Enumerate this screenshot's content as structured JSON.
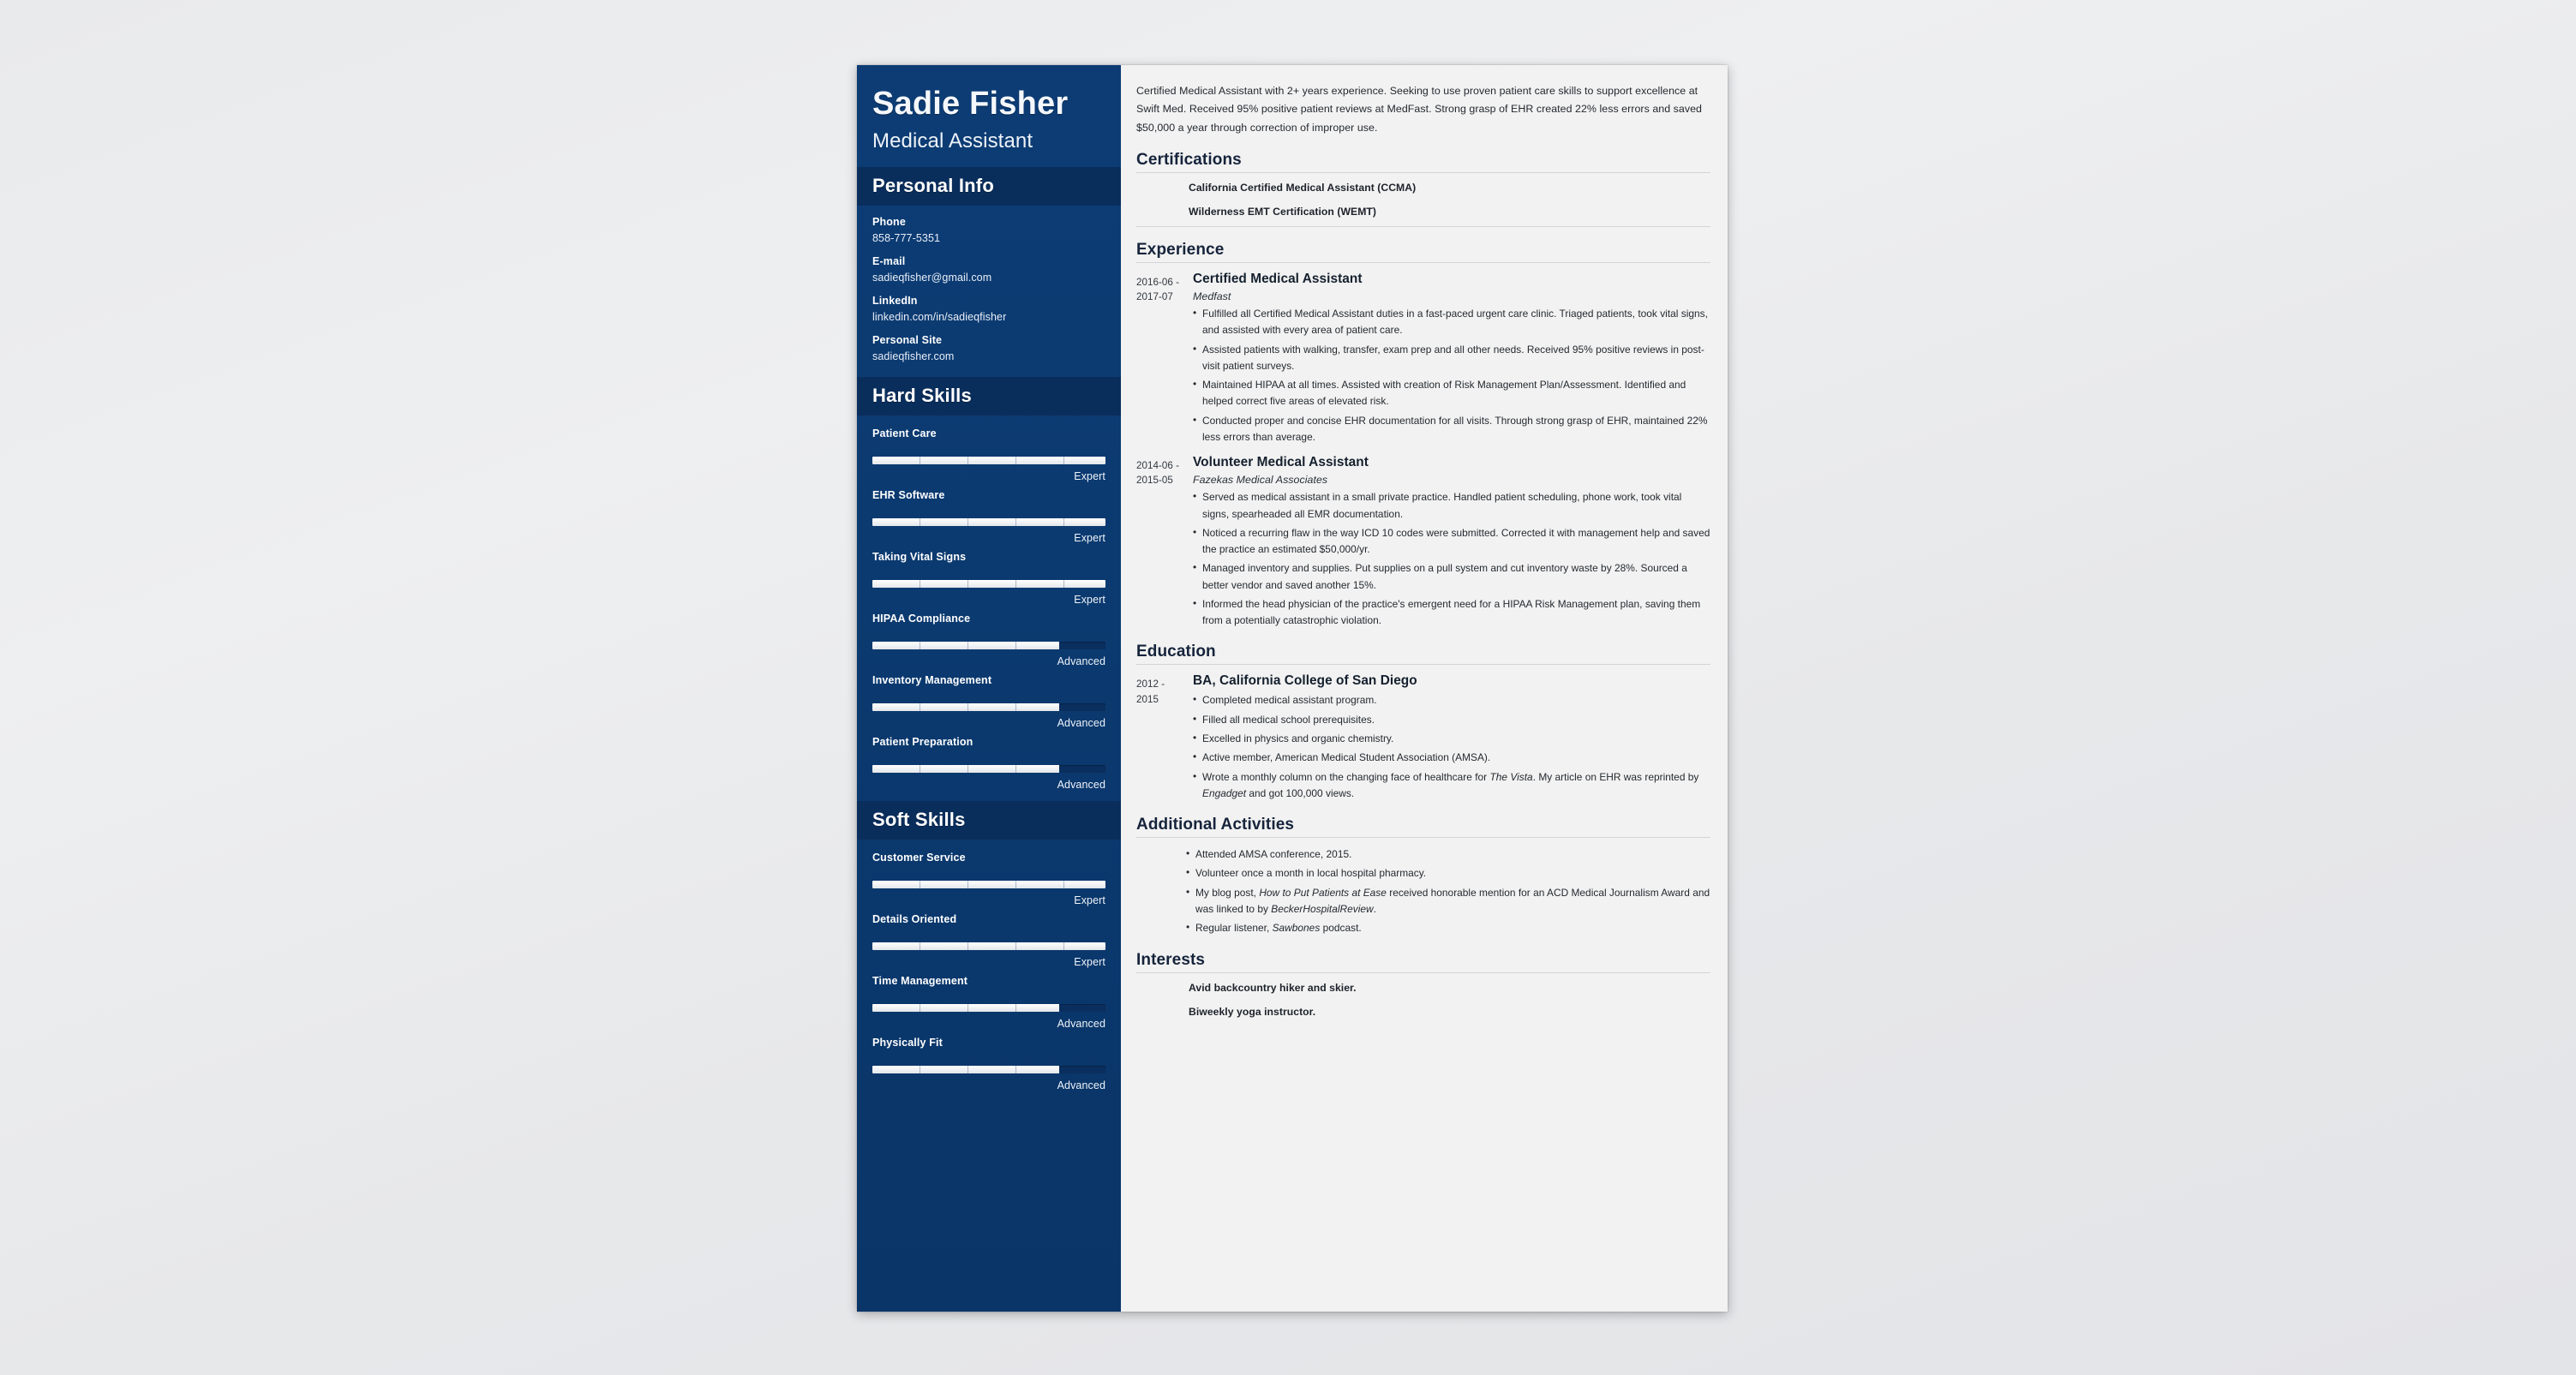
{
  "colors": {
    "sidebar_bg": "#0b3a70",
    "sidebar_header_bg": "#0a2e5c",
    "page_bg": "#f2f2f2",
    "heading_text": "#16243c",
    "bar_fill": "#ffffff"
  },
  "header": {
    "name": "Sadie Fisher",
    "job_title": "Medical Assistant"
  },
  "sidebar": {
    "personal_info": {
      "heading": "Personal Info",
      "items": [
        {
          "label": "Phone",
          "value": "858-777-5351"
        },
        {
          "label": "E-mail",
          "value": "sadieqfisher@gmail.com"
        },
        {
          "label": "LinkedIn",
          "value": "linkedin.com/in/sadieqfisher"
        },
        {
          "label": "Personal Site",
          "value": "sadieqfisher.com"
        }
      ]
    },
    "hard_skills": {
      "heading": "Hard Skills",
      "items": [
        {
          "name": "Patient Care",
          "level": "Expert",
          "percent": 100
        },
        {
          "name": "EHR Software",
          "level": "Expert",
          "percent": 100
        },
        {
          "name": "Taking Vital Signs",
          "level": "Expert",
          "percent": 100
        },
        {
          "name": "HIPAA Compliance",
          "level": "Advanced",
          "percent": 80
        },
        {
          "name": "Inventory Management",
          "level": "Advanced",
          "percent": 80
        },
        {
          "name": "Patient Preparation",
          "level": "Advanced",
          "percent": 80
        }
      ]
    },
    "soft_skills": {
      "heading": "Soft Skills",
      "items": [
        {
          "name": "Customer Service",
          "level": "Expert",
          "percent": 100
        },
        {
          "name": "Details Oriented",
          "level": "Expert",
          "percent": 100
        },
        {
          "name": "Time Management",
          "level": "Advanced",
          "percent": 80
        },
        {
          "name": "Physically Fit",
          "level": "Advanced",
          "percent": 80
        }
      ]
    }
  },
  "main": {
    "summary": "Certified Medical Assistant with 2+ years experience. Seeking to use proven patient care skills to support excellence at Swift Med. Received 95% positive patient reviews at MedFast. Strong grasp of EHR created 22% less errors and saved $50,000 a year through correction of improper use.",
    "certifications": {
      "heading": "Certifications",
      "items": [
        "California Certified Medical Assistant (CCMA)",
        "Wilderness EMT Certification (WEMT)"
      ]
    },
    "experience": {
      "heading": "Experience",
      "entries": [
        {
          "date_start": "2016-06 -",
          "date_end": "2017-07",
          "role": "Certified Medical Assistant",
          "org": "Medfast",
          "bullets": [
            "Fulfilled all Certified Medical Assistant duties in a fast-paced urgent care clinic. Triaged patients, took vital signs, and assisted with every area of patient care.",
            "Assisted patients with walking, transfer, exam prep and all other needs. Received 95% positive reviews in post-visit patient surveys.",
            "Maintained HIPAA at all times. Assisted with creation of Risk Management Plan/Assessment. Identified and helped correct five areas of elevated risk.",
            "Conducted proper and concise EHR documentation for all visits. Through strong grasp of EHR, maintained 22% less errors than average."
          ]
        },
        {
          "date_start": "2014-06 -",
          "date_end": "2015-05",
          "role": "Volunteer Medical Assistant",
          "org": "Fazekas Medical Associates",
          "bullets": [
            "Served as medical assistant in a small private practice. Handled patient scheduling, phone work, took vital signs, spearheaded all EMR documentation.",
            "Noticed a recurring flaw in the way ICD 10 codes were submitted. Corrected it with management help and saved the practice an estimated $50,000/yr.",
            "Managed inventory and supplies. Put supplies on a pull system and cut inventory waste by 28%. Sourced a better vendor and saved another 15%.",
            "Informed the head physician of the practice's emergent need for a HIPAA Risk Management plan, saving them from a potentially catastrophic violation."
          ]
        }
      ]
    },
    "education": {
      "heading": "Education",
      "entries": [
        {
          "date_start": "2012 -",
          "date_end": "2015",
          "degree": "BA, California College of San Diego",
          "bullets": [
            "Completed medical assistant program.",
            "Filled all medical school prerequisites.",
            "Excelled in physics and organic chemistry.",
            "Active member, American Medical Student Association (AMSA).",
            "Wrote a monthly column on the changing face of healthcare for The Vista. My article on EHR was reprinted by Engadget and got 100,000 views."
          ]
        }
      ]
    },
    "additional_activities": {
      "heading": "Additional Activities",
      "bullets": [
        "Attended AMSA conference, 2015.",
        "Volunteer once a month in local hospital pharmacy.",
        "My blog post, How to Put Patients at Ease received honorable mention for an ACD Medical Journalism Award and was linked to by BeckerHospitalReview.",
        "Regular listener, Sawbones podcast."
      ]
    },
    "interests": {
      "heading": "Interests",
      "items": [
        "Avid backcountry hiker and skier.",
        "Biweekly yoga instructor."
      ]
    }
  }
}
